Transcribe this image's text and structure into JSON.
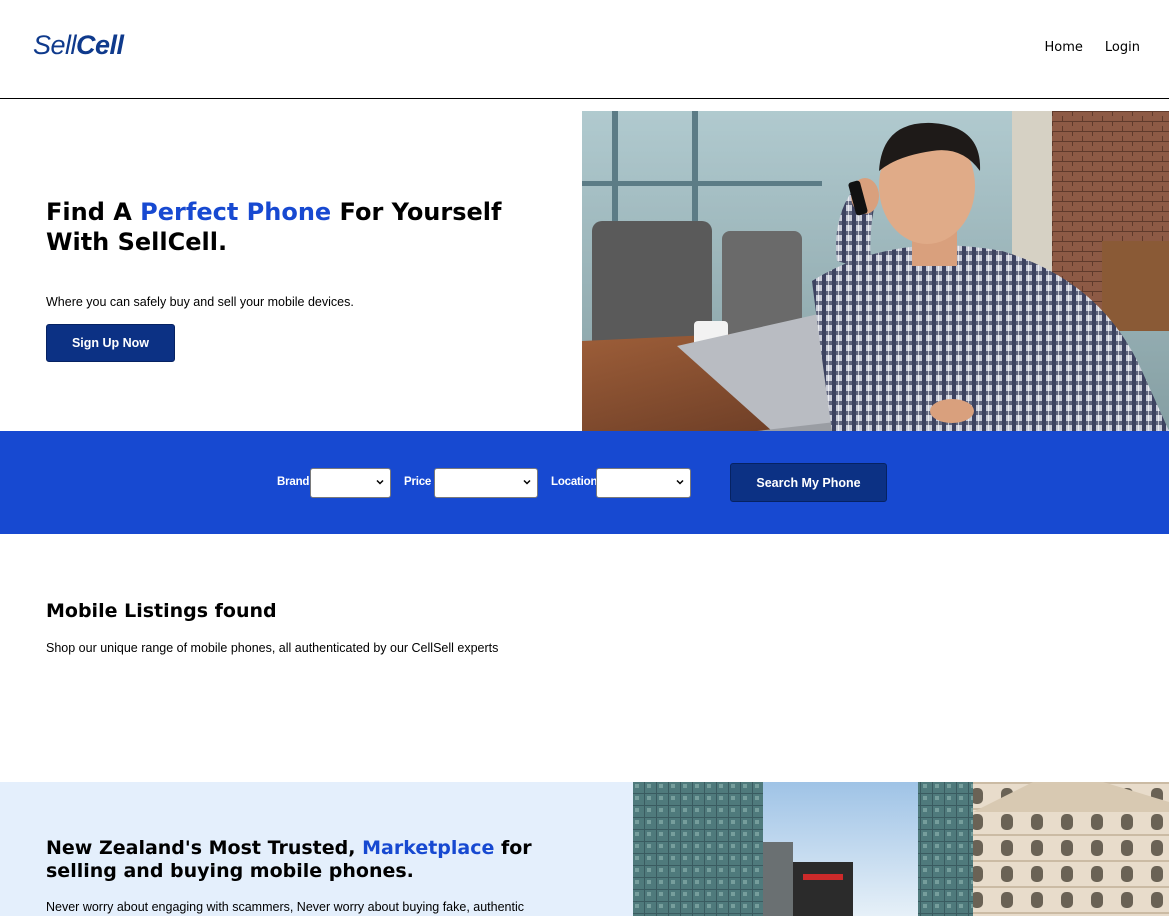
{
  "header": {
    "logo_light": "Sell",
    "logo_bold": "Cell",
    "nav": [
      {
        "label": "Home"
      },
      {
        "label": "Login"
      }
    ]
  },
  "hero": {
    "title_prefix": "Find A ",
    "title_accent": "Perfect Phone",
    "title_suffix": " For Yourself With SellCell.",
    "subtitle": "Where you can safely buy and sell your mobile devices.",
    "cta_label": "Sign Up Now"
  },
  "search": {
    "brand_label": "Brand",
    "brand_value": "",
    "price_label": "Price",
    "price_value": "",
    "location_label": "Location",
    "location_value": "",
    "button_label": "Search My Phone"
  },
  "listings": {
    "title": "Mobile Listings found",
    "subtitle": "Shop our unique range of mobile phones, all authenticated by our CellSell experts"
  },
  "trust": {
    "title_prefix": "New Zealand's Most Trusted, ",
    "title_accent": "Marketplace",
    "title_suffix": " for selling and buying mobile phones.",
    "body": "Never worry about engaging with scammers, Never worry about buying fake, authentic"
  },
  "colors": {
    "brand_blue": "#1749d1",
    "navy": "#0c3184",
    "trust_bg": "#e4effc"
  }
}
